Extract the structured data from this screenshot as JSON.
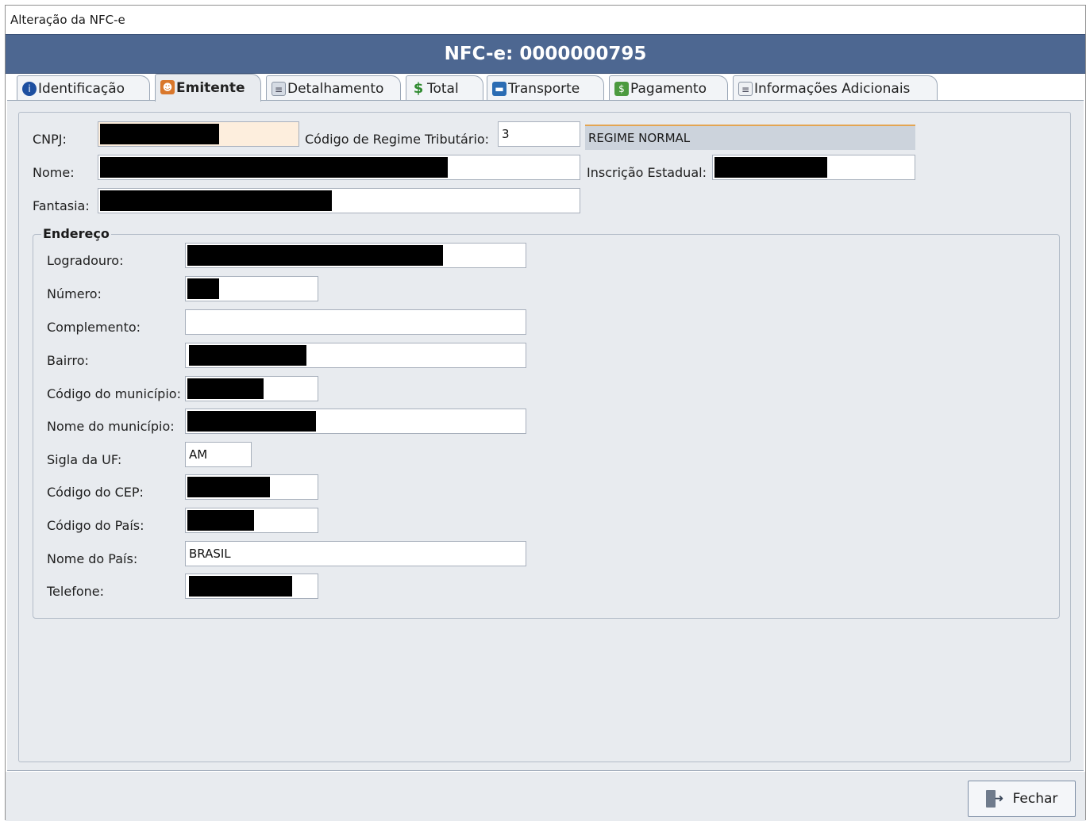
{
  "window": {
    "title": "Alteração da NFC-e"
  },
  "header": {
    "title": "NFC-e: 0000000795"
  },
  "tabs": [
    {
      "label": "Identificação",
      "icon": "info-icon"
    },
    {
      "label": "Emitente",
      "icon": "people-icon"
    },
    {
      "label": "Detalhamento",
      "icon": "document-icon"
    },
    {
      "label": "Total",
      "icon": "dollar-icon"
    },
    {
      "label": "Transporte",
      "icon": "bus-icon"
    },
    {
      "label": "Pagamento",
      "icon": "payment-icon"
    },
    {
      "label": "Informações Adicionais",
      "icon": "notes-icon"
    }
  ],
  "emitente": {
    "cnpj_label": "CNPJ:",
    "regime_label": "Código de Regime Tributário:",
    "regime_value": "3",
    "regime_desc": "REGIME NORMAL",
    "nome_label": "Nome:",
    "ie_label": "Inscrição Estadual:",
    "fantasia_label": "Fantasia:"
  },
  "endereco": {
    "title": "Endereço",
    "logradouro_label": "Logradouro:",
    "numero_label": "Número:",
    "complemento_label": "Complemento:",
    "complemento_value": "",
    "bairro_label": "Bairro:",
    "cod_municipio_label": "Código do município:",
    "nome_municipio_label": "Nome do município:",
    "uf_label": "Sigla da UF:",
    "uf_value": "AM",
    "cep_label": "Código do CEP:",
    "cod_pais_label": "Código do País:",
    "nome_pais_label": "Nome do País:",
    "nome_pais_value": "BRASIL",
    "telefone_label": "Telefone:"
  },
  "footer": {
    "close_label": "Fechar"
  },
  "colors": {
    "header": "#4d6791",
    "content_bg": "#e8ebef",
    "regime_accent": "#e3a552"
  }
}
